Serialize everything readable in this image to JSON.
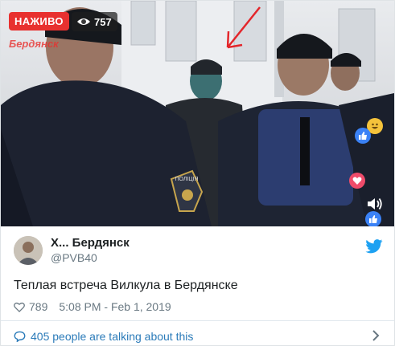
{
  "video": {
    "live_label": "НАЖИВО",
    "view_count": "757",
    "channel_logo": "Бердянск",
    "reactions": [
      "laugh-reaction-icon",
      "like-reaction-icon",
      "love-reaction-icon",
      "like-reaction-icon"
    ],
    "annotation_color": "#e3262b"
  },
  "tweet": {
    "author_name": "Х... Бердянск",
    "author_handle": "@PVB40",
    "text": "Теплая встреча Вилкула в Бердянске",
    "like_count": "789",
    "timestamp": "5:08 PM - Feb 1, 2019",
    "footer_text": "405 people are talking about this"
  },
  "colors": {
    "twitter_blue": "#1da1f2",
    "link_blue": "#2b7bb9",
    "secondary_text": "#697882"
  }
}
